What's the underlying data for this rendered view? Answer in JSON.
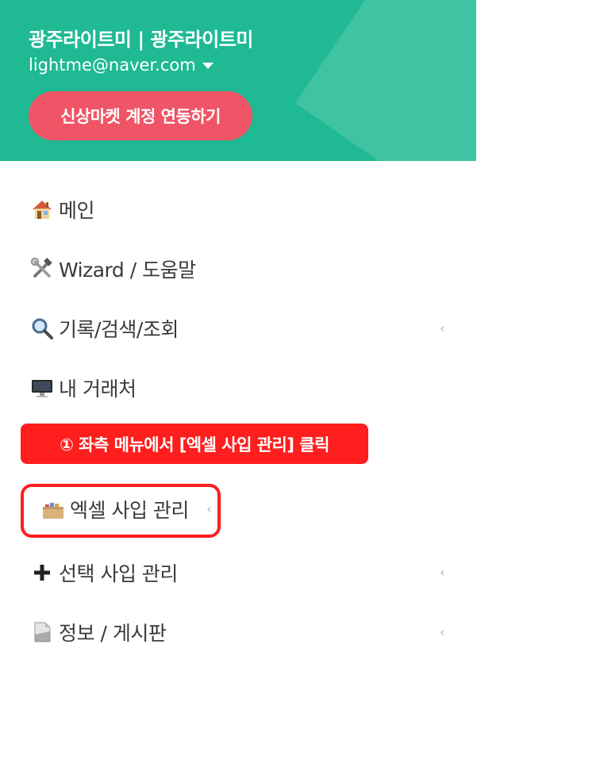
{
  "header": {
    "account_name": "광주라이트미 | 광주라이트미",
    "email": "lightme@naver.com",
    "link_button_label": "신상마켓 계정 연동하기",
    "colors": {
      "background": "#1fb994",
      "accent_shape": "#3fc3a2",
      "button": "#ef5566"
    }
  },
  "menu": {
    "items": [
      {
        "label": "메인",
        "icon": "house-icon",
        "has_submenu": false
      },
      {
        "label": "Wizard / 도움말",
        "icon": "hammer-and-wrench-icon",
        "has_submenu": false
      },
      {
        "label": "기록/검색/조회",
        "icon": "magnifier-icon",
        "has_submenu": true
      },
      {
        "label": "내 거래처",
        "icon": "desktop-computer-icon",
        "has_submenu": false
      },
      {
        "label": "엑셀 사입 관리",
        "icon": "box-icon",
        "has_submenu": true
      },
      {
        "label": "선택 사입 관리",
        "icon": "plus-icon",
        "has_submenu": true
      },
      {
        "label": "정보 / 게시판",
        "icon": "document-icon",
        "has_submenu": true
      }
    ],
    "chevron_glyph": "‹"
  },
  "annotation": {
    "callout_text": "① 좌측 메뉴에서 [엑셀 사입 관리] 클릭",
    "color": "#ff1e1e"
  }
}
